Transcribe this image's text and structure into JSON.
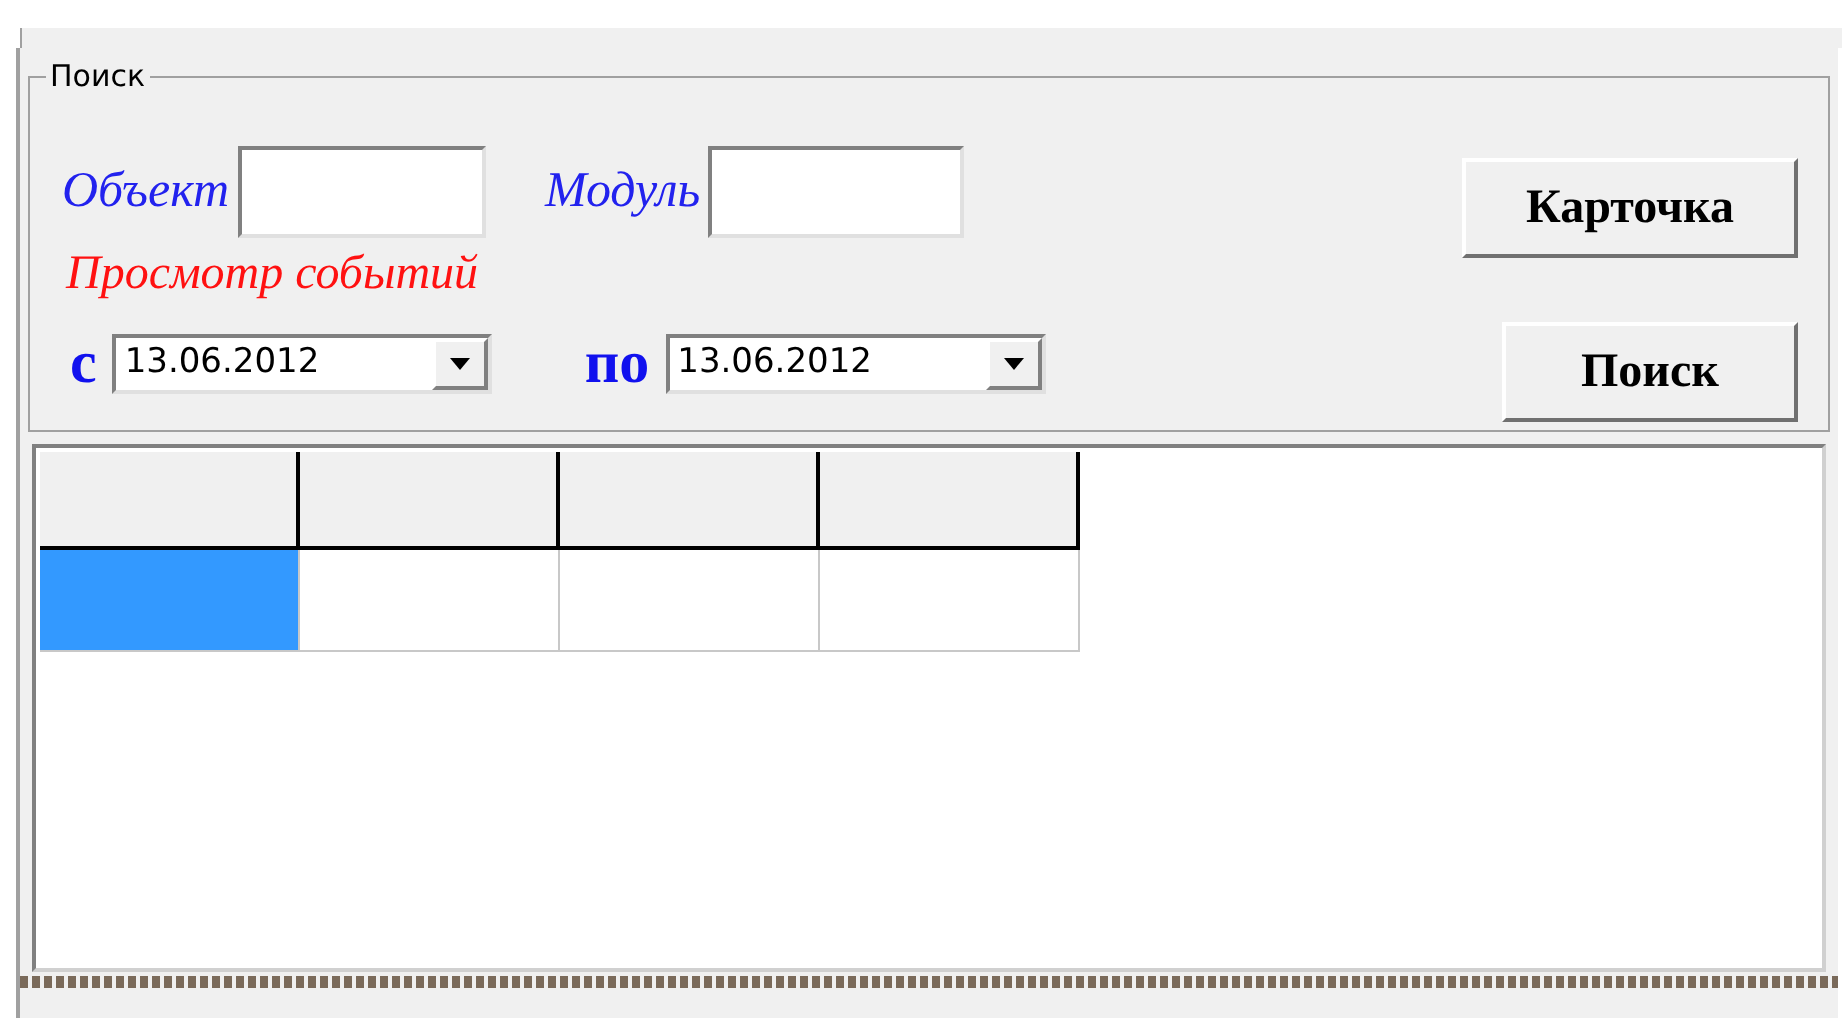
{
  "search_group": {
    "title": "Поиск",
    "object_label": "Объект",
    "module_label": "Модуль",
    "events_label": "Просмотр событий",
    "from_label": "с",
    "from_date": "13.06.2012",
    "to_label": "по",
    "to_date": "13.06.2012",
    "buttons": [
      "Карточка",
      "Поиск"
    ]
  },
  "grid": {
    "rows": [
      {
        "cells": [
          {
            "selected": true
          },
          {
            "selected": false
          },
          {
            "selected": false
          },
          {
            "selected": false
          }
        ]
      }
    ]
  }
}
